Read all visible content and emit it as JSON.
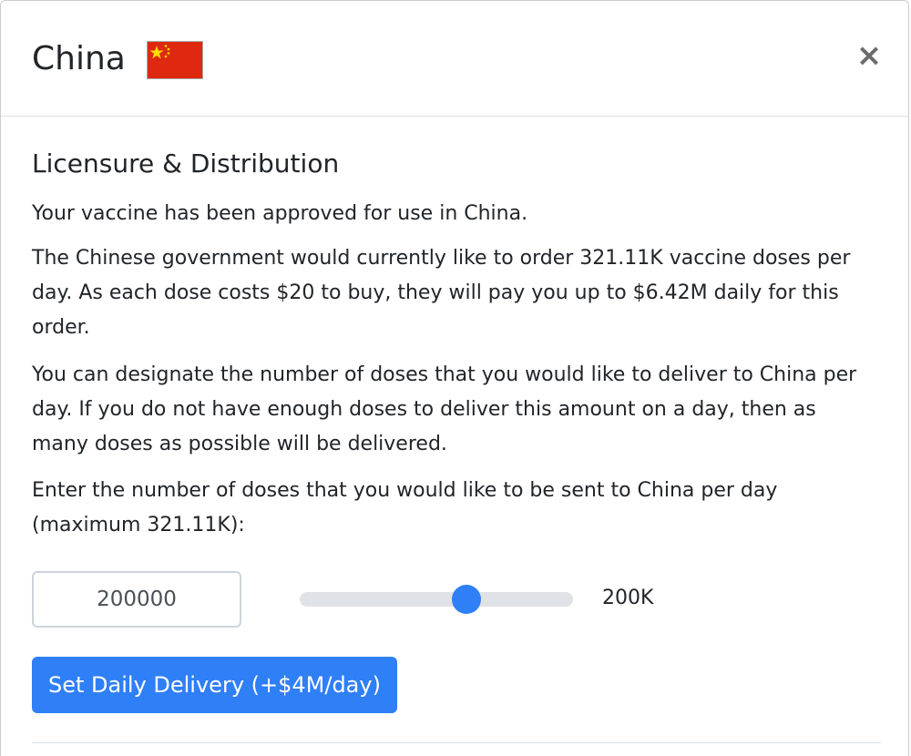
{
  "header": {
    "title": "China",
    "flag_icon": "china-flag-icon",
    "close_label": "×"
  },
  "section": {
    "heading": "Licensure & Distribution",
    "p1": "Your vaccine has been approved for use in China.",
    "p2": "The Chinese government would currently like to order 321.11K vaccine doses per day. As each dose costs $20 to buy, they will pay you up to $6.42M daily for this order.",
    "p3": "You can designate the number of doses that you would like to deliver to China per day. If you do not have enough doses to deliver this amount on a day, then as many doses as possible will be delivered.",
    "p4": "Enter the number of doses that you would like to be sent to China per day (maximum 321.11K):"
  },
  "delivery": {
    "input_value": "200000",
    "slider_min": 0,
    "slider_max": 321110,
    "slider_value": 200000,
    "slider_label": "200K",
    "button_label": "Set Daily Delivery (+$4M/day)"
  },
  "colors": {
    "accent": "#2f7ff7",
    "flag_red": "#de2910",
    "flag_yellow": "#ffde00"
  }
}
